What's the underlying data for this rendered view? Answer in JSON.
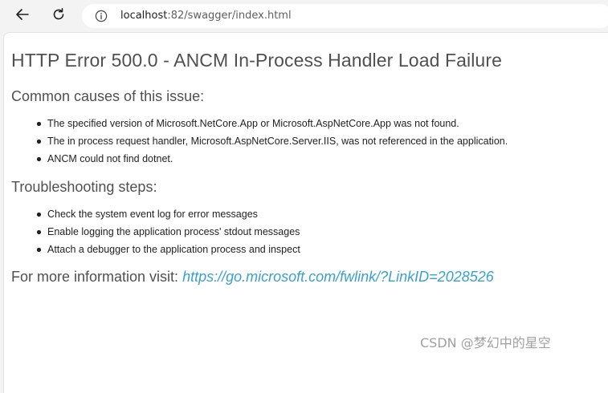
{
  "browser": {
    "url_host": "localhost",
    "url_rest": ":82/swagger/index.html"
  },
  "page": {
    "title": "HTTP Error 500.0 - ANCM In-Process Handler Load Failure",
    "causes_heading": "Common causes of this issue:",
    "causes": [
      "The specified version of Microsoft.NetCore.App or Microsoft.AspNetCore.App was not found.",
      "The in process request handler, Microsoft.AspNetCore.Server.IIS, was not referenced in the application.",
      "ANCM could not find dotnet."
    ],
    "steps_heading": "Troubleshooting steps:",
    "steps": [
      "Check the system event log for error messages",
      "Enable logging the application process' stdout messages",
      "Attach a debugger to the application process and inspect"
    ],
    "more_info_label": "For more information visit: ",
    "more_info_link": "https://go.microsoft.com/fwlink/?LinkID=2028526"
  },
  "watermark": "CSDN @梦幻中的星空"
}
